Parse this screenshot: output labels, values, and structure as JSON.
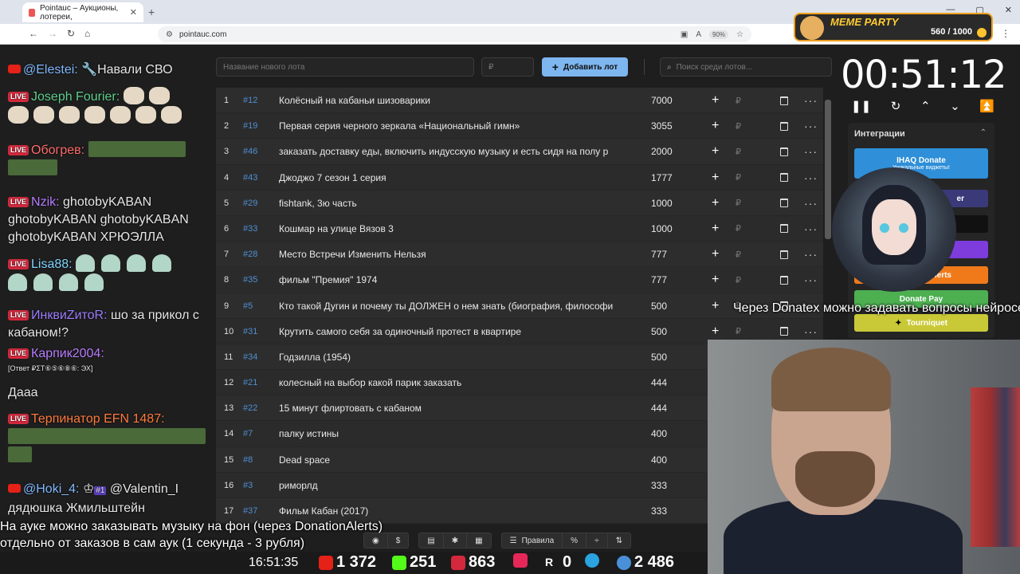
{
  "browser": {
    "tab_title": "Pointauc – Аукционы, лотереи,",
    "url": "pointauc.com",
    "zoom": "90%"
  },
  "meme_party": {
    "title": "MEME PARTY",
    "count": "560 / 1000"
  },
  "chat": [
    {
      "user": "@Elestei:",
      "text": "Навали СВО",
      "color": "#7fb8ff"
    },
    {
      "user": "Joseph Fourier:",
      "text": "",
      "color": "#5fd08d"
    },
    {
      "user": "Обогрев:",
      "text": "",
      "color": "#ff6b6b"
    },
    {
      "user": "Nzik:",
      "text": "ghotobyKABAN ghotobyKABAN ghotobyKABAN ghotobyKABAN ХРЮЭЛЛА",
      "color": "#b77dff"
    },
    {
      "user": "Lisa88:",
      "text": "",
      "color": "#7fd4ff"
    },
    {
      "user": "ИнквиZитоR:",
      "text": "шо за прикол с кабаном!?",
      "color": "#9b7dff"
    },
    {
      "user": "Карпик2004:",
      "text": "",
      "color": "#b77dff"
    },
    {
      "user": "",
      "text": "[Ответ ₽ΣΤ⑥⑤⑥⑧⑥: ЭХ]",
      "color": "#aaaaaa"
    },
    {
      "user": "",
      "text": "Дааа",
      "color": "#ffffff"
    },
    {
      "user": "Терпинатор EFN 1487:",
      "text": "",
      "color": "#ff7a3d"
    },
    {
      "user": "@Hoki_4:",
      "text": "@Valentin_I дядюшка Жмильштейн",
      "color": "#7fb8ff"
    },
    {
      "user": "",
      "text": "#1",
      "color": "#9b7dff"
    }
  ],
  "controls": {
    "new_lot_placeholder": "Название нового лота",
    "amount_placeholder": "₽",
    "add_lot": "Добавить лот",
    "search_placeholder": "Поиск среди лотов..."
  },
  "lots": [
    {
      "n": "1",
      "id": "#12",
      "name": "Колёсный на кабаньи шизоварики",
      "amount": "7000"
    },
    {
      "n": "2",
      "id": "#19",
      "name": "Первая серия черного зеркала «Национальный гимн»",
      "amount": "3055"
    },
    {
      "n": "3",
      "id": "#46",
      "name": "заказать доставку еды, включить индусскую музыку и есть сидя на полу р",
      "amount": "2000"
    },
    {
      "n": "4",
      "id": "#43",
      "name": "Джоджо 7 сезон 1 серия",
      "amount": "1777"
    },
    {
      "n": "5",
      "id": "#29",
      "name": "fishtank, 3ю часть",
      "amount": "1000"
    },
    {
      "n": "6",
      "id": "#33",
      "name": "Кошмар на улице Вязов 3",
      "amount": "1000"
    },
    {
      "n": "7",
      "id": "#28",
      "name": "Место Встречи Изменить Нельзя",
      "amount": "777"
    },
    {
      "n": "8",
      "id": "#35",
      "name": "фильм \"Премия\" 1974",
      "amount": "777"
    },
    {
      "n": "9",
      "id": "#5",
      "name": "Кто такой Дугин и почему ты ДОЛЖЕН о нем знать (биография, философи",
      "amount": "500"
    },
    {
      "n": "10",
      "id": "#31",
      "name": "Крутить самого себя за одиночный протест в квартире",
      "amount": "500"
    },
    {
      "n": "11",
      "id": "#34",
      "name": "Годзилла (1954)",
      "amount": "500"
    },
    {
      "n": "12",
      "id": "#21",
      "name": "колесный на выбор какой парик заказать",
      "amount": "444"
    },
    {
      "n": "13",
      "id": "#22",
      "name": "15 минут флиртовать с кабаном",
      "amount": "444"
    },
    {
      "n": "14",
      "id": "#7",
      "name": "палку истины",
      "amount": "400"
    },
    {
      "n": "15",
      "id": "#8",
      "name": "Dead space",
      "amount": "400"
    },
    {
      "n": "16",
      "id": "#3",
      "name": "риморлд",
      "amount": "333"
    },
    {
      "n": "17",
      "id": "#37",
      "name": "Фильм Кабан (2017)",
      "amount": "333"
    }
  ],
  "timer": {
    "value": "00:51:12"
  },
  "integrations": {
    "title": "Интеграции",
    "items": [
      {
        "label": "IHAQ Donate",
        "sub": "Уникальные виджеты!",
        "color": "#2f8fd8"
      },
      {
        "label": "Donate Pay",
        "color": "#4caf50"
      },
      {
        "label": "Tourniquet",
        "color": "#c9c937"
      }
    ],
    "partial": [
      "er",
      "lerts"
    ]
  },
  "overlay": {
    "donatex": "Через Donatex можно задавать вопросы нейросети",
    "line1": "На ауке можно заказывать музыку на фон (через DonationAlerts)",
    "line2": "отдельно от заказов в сам аук (1 секунда - 3 рубля)"
  },
  "bottom": {
    "rules": "Правила",
    "percent": "%"
  },
  "stats": {
    "clock": "16:51:35",
    "youtube": "1 372",
    "kick": "251",
    "live": "863",
    "rutube": "0",
    "telegram": "",
    "viewers": "2 486"
  }
}
